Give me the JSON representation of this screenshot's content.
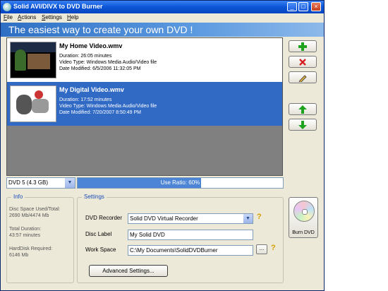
{
  "window": {
    "title": "Solid AVI/DIVX to DVD Burner",
    "controls": [
      "_",
      "□",
      "×"
    ]
  },
  "menu": [
    "File",
    "Actions",
    "Settings",
    "Help"
  ],
  "banner": "The easiest way to create your own DVD !",
  "videos": [
    {
      "name": "My Home Video.wmv",
      "duration": "Duration: 26:05 minutes",
      "type": "Video Type: Windows Media Audio/Video file",
      "modified": "Date Modified: 6/5/2006 11:32:05 PM",
      "selected": false
    },
    {
      "name": "My Digital Video.wmv",
      "duration": "Duration: 17:52 minutes",
      "type": "Video Type: Windows Media Audio/Video file",
      "modified": "Date Modified: 7/20/2007 8:50:49 PM",
      "selected": true
    }
  ],
  "side_buttons": {
    "add": "add-icon",
    "remove": "remove-icon",
    "edit": "pencil-icon",
    "move_up": "arrow-up-icon",
    "move_down": "arrow-down-icon"
  },
  "dvd_select": {
    "value": "DVD 5  (4.3 GB)"
  },
  "use_ratio": {
    "label": "Use Ratio: 60%",
    "value": 0.6
  },
  "info": {
    "legend": "Info",
    "disk_space_label": "Disc Space Used/Total:",
    "disk_space_value": "2690 Mb/4474 Mb",
    "total_duration_label": "Total Duration:",
    "total_duration_value": "43:57 minutes",
    "harddisk_label": "HardDisk Required:",
    "harddisk_value": "6146 Mb"
  },
  "settings": {
    "legend": "Settings",
    "recorder_label": "DVD Recorder",
    "recorder_value": "Solid DVD Virtual Recorder",
    "disc_label_label": "Disc Label",
    "disc_label_value": "My Solid DVD",
    "workspace_label": "Work Space",
    "workspace_value": "C:\\My Documents\\SolidDVDBurner",
    "browse_label": "...",
    "help_mark": "?",
    "advanced_label": "Advanced Settings..."
  },
  "burn_button": {
    "label": "Burn DVD"
  },
  "colors": {
    "title_bar": "#0a55d6",
    "banner": "#2e6fc4",
    "selection": "#316ac5",
    "list_bg": "#808080",
    "window_bg": "#ece9d8",
    "add_green": "#1fa31f",
    "remove_red": "#d42020"
  }
}
